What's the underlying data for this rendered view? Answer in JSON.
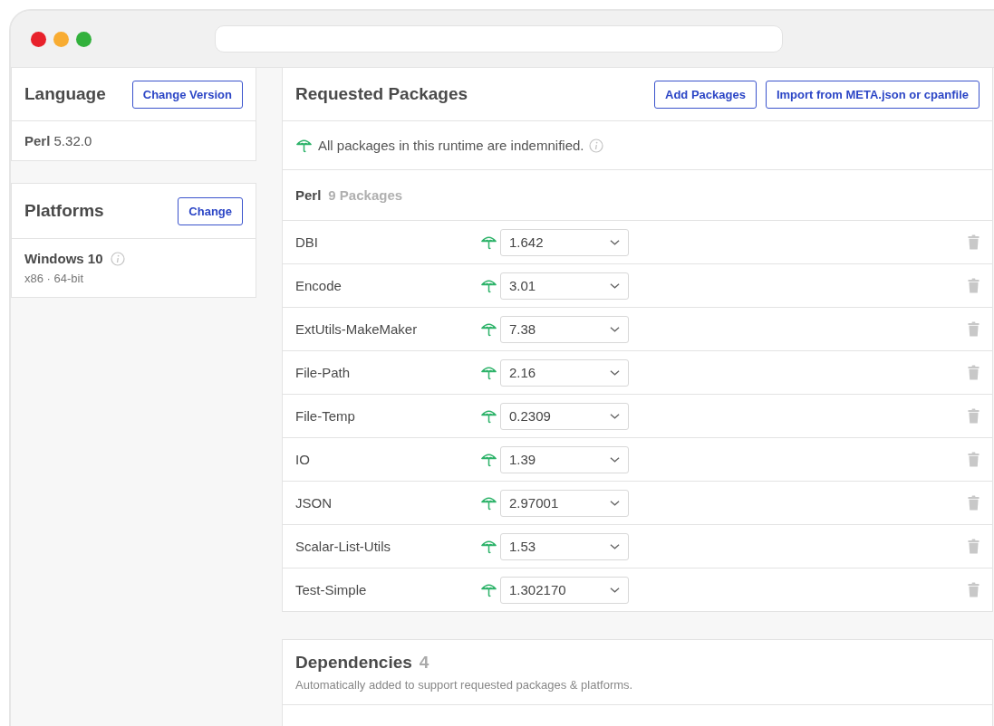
{
  "language": {
    "title": "Language",
    "button": "Change Version",
    "name": "Perl",
    "version": "5.32.0"
  },
  "platforms": {
    "title": "Platforms",
    "button": "Change",
    "name": "Windows 10",
    "detail": "x86 · 64-bit"
  },
  "requested": {
    "title": "Requested Packages",
    "buttons": [
      "Add Packages",
      "Import from META.json or cpanfile"
    ],
    "notice": "All packages in this runtime are indemnified.",
    "group": {
      "name": "Perl",
      "count": "9 Packages"
    },
    "packages": [
      {
        "name": "DBI",
        "indemnified": true,
        "version": "1.642"
      },
      {
        "name": "Encode",
        "indemnified": true,
        "version": "3.01"
      },
      {
        "name": "ExtUtils-MakeMaker",
        "indemnified": true,
        "version": "7.38"
      },
      {
        "name": "File-Path",
        "indemnified": true,
        "version": "2.16"
      },
      {
        "name": "File-Temp",
        "indemnified": true,
        "version": "0.2309"
      },
      {
        "name": "IO",
        "indemnified": true,
        "version": "1.39"
      },
      {
        "name": "JSON",
        "indemnified": true,
        "version": "2.97001"
      },
      {
        "name": "Scalar-List-Utils",
        "indemnified": true,
        "version": "1.53"
      },
      {
        "name": "Test-Simple",
        "indemnified": true,
        "version": "1.302170"
      }
    ]
  },
  "dependencies": {
    "title": "Dependencies",
    "count": "4",
    "subtitle": "Automatically added to support requested packages & platforms."
  }
}
